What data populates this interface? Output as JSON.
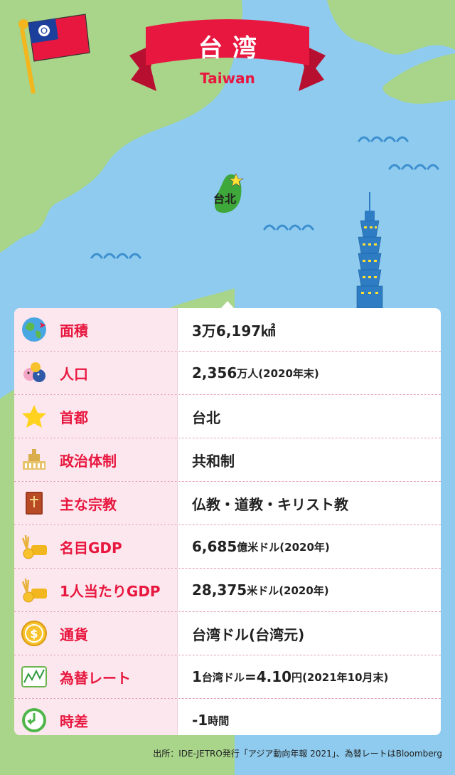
{
  "header": {
    "title": "台湾",
    "subtitle": "Taiwan"
  },
  "map": {
    "city_label": "台北"
  },
  "rows": [
    {
      "label": "面積",
      "icon": "globe-icon",
      "value": "3万6,197㎢",
      "note": ""
    },
    {
      "label": "人口",
      "icon": "people-icon",
      "value": "2,356",
      "value_suffix": "万人",
      "note": "(2020年末)"
    },
    {
      "label": "首都",
      "icon": "star-icon",
      "value": "台北",
      "note": ""
    },
    {
      "label": "政治体制",
      "icon": "government-building-icon",
      "value": "共和制",
      "note": ""
    },
    {
      "label": "主な宗教",
      "icon": "holy-book-icon",
      "value": "仏教・道教・キリスト教",
      "note": ""
    },
    {
      "label": "名目GDP",
      "icon": "wheat-coins-icon",
      "value": "6,685",
      "value_suffix": "億米ドル",
      "note": "(2020年)"
    },
    {
      "label": "1人当たりGDP",
      "icon": "wheat-coins-icon",
      "value": "28,375",
      "value_suffix": "米ドル",
      "note": "(2020年)"
    },
    {
      "label": "通貨",
      "icon": "coin-icon",
      "value": "台湾ドル(台湾元)",
      "note": ""
    },
    {
      "label": "為替レート",
      "icon": "chart-icon",
      "value": "1",
      "value_suffix": "台湾ドル",
      "value2": "=4.10",
      "value2_suffix": "円",
      "note": "(2021年10月末)"
    },
    {
      "label": "時差",
      "icon": "clock-arrow-icon",
      "value": "-1",
      "value_suffix": "時間",
      "note": ""
    }
  ],
  "footer": {
    "source": "出所：IDE-JETRO発行「アジア動向年報 2021」、為替レートはBloomberg"
  },
  "colors": {
    "sea": "#8ecbef",
    "land": "#a8d58a",
    "accent": "#e8173f",
    "label_bg": "#fde7ee",
    "taiwan": "#3fa83a"
  }
}
